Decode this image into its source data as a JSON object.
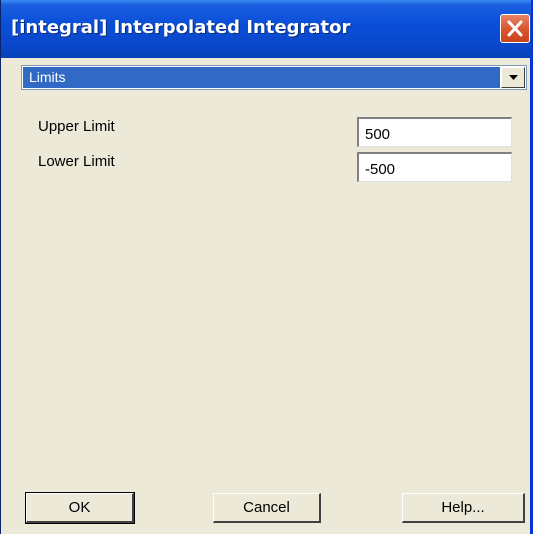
{
  "window": {
    "title": "[integral] Interpolated Integrator"
  },
  "dropdown": {
    "selected": "Limits"
  },
  "fields": [
    {
      "label": "Upper Limit",
      "value": "500"
    },
    {
      "label": "Lower Limit",
      "value": "-500"
    }
  ],
  "buttons": {
    "ok": "OK",
    "cancel": "Cancel",
    "help": "Help..."
  },
  "colors": {
    "titlebar": "#0a4fd8",
    "selection": "#316ac5",
    "dialog_bg": "#ece9d8",
    "close_button": "#d9582f"
  },
  "icons": {
    "close": "close-icon",
    "dropdown": "chevron-down-icon"
  }
}
